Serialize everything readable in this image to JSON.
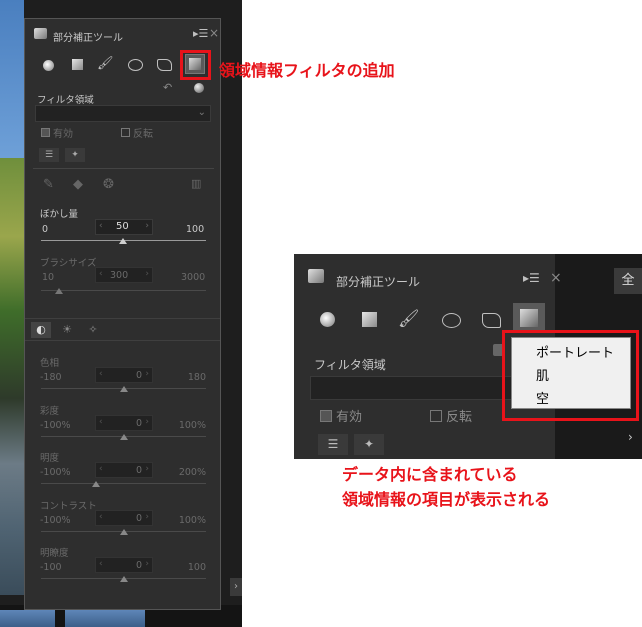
{
  "panel": {
    "title": "部分補正ツール",
    "filter_area_label": "フィルタ領域",
    "enabled_label": "有効",
    "invert_label": "反転",
    "blur_label": "ぼかし量",
    "blur_min": "0",
    "blur_value": "50",
    "blur_max": "100",
    "brush_size_label": "ブラシサイズ",
    "brush_min": "10",
    "brush_value": "300",
    "brush_max": "3000",
    "adjust": [
      {
        "label": "色相",
        "min": "-180",
        "value": "0",
        "max": "180",
        "level": 0.5
      },
      {
        "label": "彩度",
        "min": "-100%",
        "value": "0",
        "max": "100%",
        "level": 0.5
      },
      {
        "label": "明度",
        "min": "-100%",
        "value": "0",
        "max": "200%",
        "level": 0.333
      },
      {
        "label": "コントラスト",
        "min": "-100%",
        "value": "0",
        "max": "100%",
        "level": 0.5
      },
      {
        "label": "明瞭度",
        "min": "-100",
        "value": "0",
        "max": "100",
        "level": 0.5
      }
    ]
  },
  "annotations": {
    "add_filter": "領域情報フィルタの追加",
    "menu_note_line1": "データ内に含まれている",
    "menu_note_line2": "領域情報の項目が表示される"
  },
  "zoom": {
    "title": "部分補正ツール",
    "filter_area_label": "フィルタ領域",
    "enabled_label": "有効",
    "invert_label": "反転",
    "corner_text": "全"
  },
  "menu": {
    "items": [
      "ポートレート",
      "肌",
      "空"
    ]
  },
  "colors": {
    "accent": "#e8131a",
    "panel": "#2e2e2e"
  }
}
